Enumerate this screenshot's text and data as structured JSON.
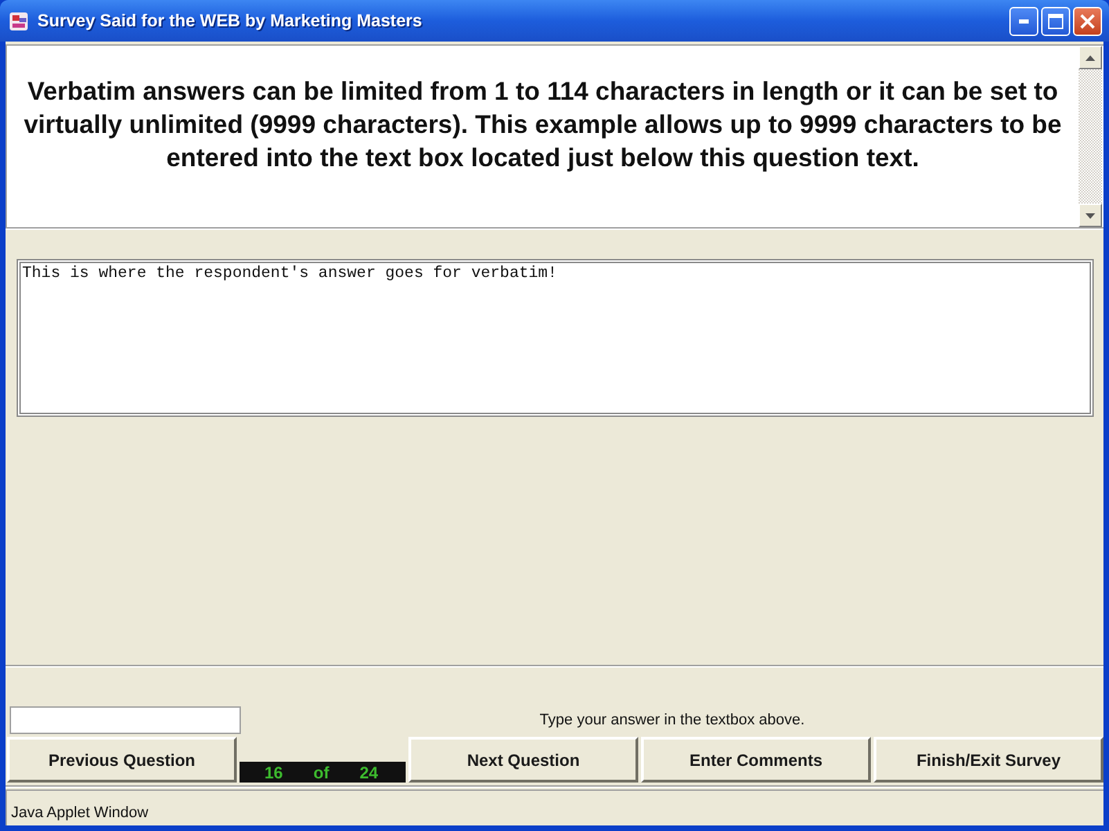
{
  "window": {
    "title": "Survey Said for the WEB by Marketing Masters"
  },
  "question": {
    "text": "Verbatim answers can be limited from 1 to 114 characters in length or it can be set to virtually unlimited (9999 characters). This example allows up to 9999 characters to be entered into the text box located just below this question text."
  },
  "answer": {
    "value": "This is where the respondent's answer goes for verbatim!"
  },
  "hint": "Type your answer in the textbox above.",
  "nav": [
    {
      "kind": "button",
      "label": "Previous Question"
    },
    {
      "kind": "counter",
      "current": "16",
      "of": "of",
      "total": "24"
    },
    {
      "kind": "button",
      "label": "Next Question"
    },
    {
      "kind": "button",
      "label": "Enter Comments"
    },
    {
      "kind": "button",
      "label": "Finish/Exit Survey"
    }
  ],
  "status_bar": {
    "text": "Java Applet Window"
  }
}
